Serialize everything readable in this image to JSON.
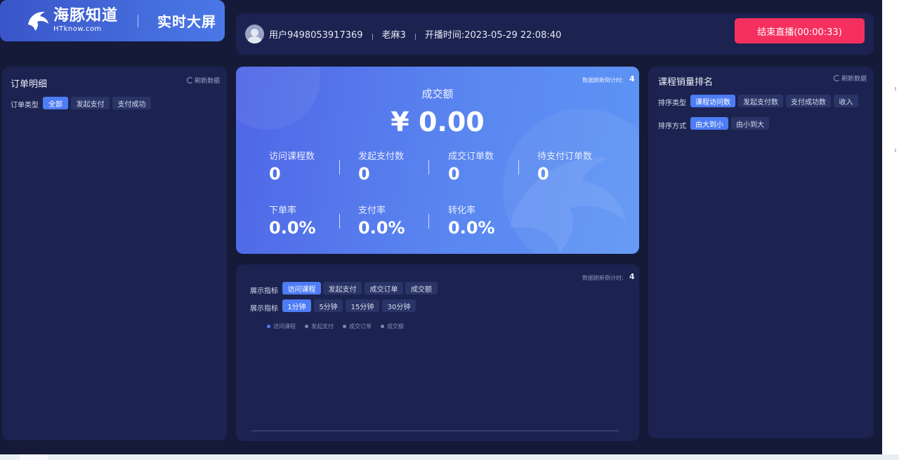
{
  "logo": {
    "brand": "海豚知道",
    "sub": "HTknow.com",
    "screen_title": "实时大屏"
  },
  "header": {
    "user": "用户9498053917369",
    "teacher": "老麻3",
    "start_time": "开播时间:2023-05-29 22:08:40",
    "end_button": "结束直播(00:00:33)"
  },
  "order_panel": {
    "title": "订单明细",
    "refresh": "刷新数据",
    "filter_label": "订单类型",
    "filters": [
      "全部",
      "发起支付",
      "支付成功"
    ],
    "active_filter": "全部"
  },
  "stats": {
    "countdown_label": "数据刷新倒计时:",
    "countdown": "4",
    "title": "成交额",
    "amount": "¥ 0.00",
    "row1": [
      {
        "label": "访问课程数",
        "value": "0"
      },
      {
        "label": "发起支付数",
        "value": "0"
      },
      {
        "label": "成交订单数",
        "value": "0"
      },
      {
        "label": "待支付订单数",
        "value": "0"
      }
    ],
    "row2": [
      {
        "label": "下单率",
        "value": "0.0%"
      },
      {
        "label": "支付率",
        "value": "0.0%"
      },
      {
        "label": "转化率",
        "value": "0.0%"
      }
    ]
  },
  "chart_panel": {
    "countdown_label": "数据刷新倒计时:",
    "countdown": "4",
    "metric_label": "展示指标",
    "metrics": [
      "访问课程",
      "发起支付",
      "成交订单",
      "成交额"
    ],
    "active_metric": "访问课程",
    "interval_label": "展示指标",
    "intervals": [
      "1分钟",
      "5分钟",
      "15分钟",
      "30分钟"
    ],
    "active_interval": "1分钟",
    "legend": [
      "访问课程",
      "发起支付",
      "成交订单",
      "成交额"
    ]
  },
  "rank_panel": {
    "title": "课程销量排名",
    "refresh": "刷新数据",
    "sort_type_label": "排序类型",
    "sort_types": [
      "课程访问数",
      "发起支付数",
      "支付成功数",
      "收入"
    ],
    "active_sort_type": "课程访问数",
    "sort_order_label": "排序方式",
    "sort_orders": [
      "由大到小",
      "由小到大"
    ],
    "active_sort_order": "由大到小"
  },
  "colors": {
    "background": "#141a38",
    "panel": "#1c2350",
    "accent": "#4d7cf5",
    "danger": "#f5305f"
  }
}
